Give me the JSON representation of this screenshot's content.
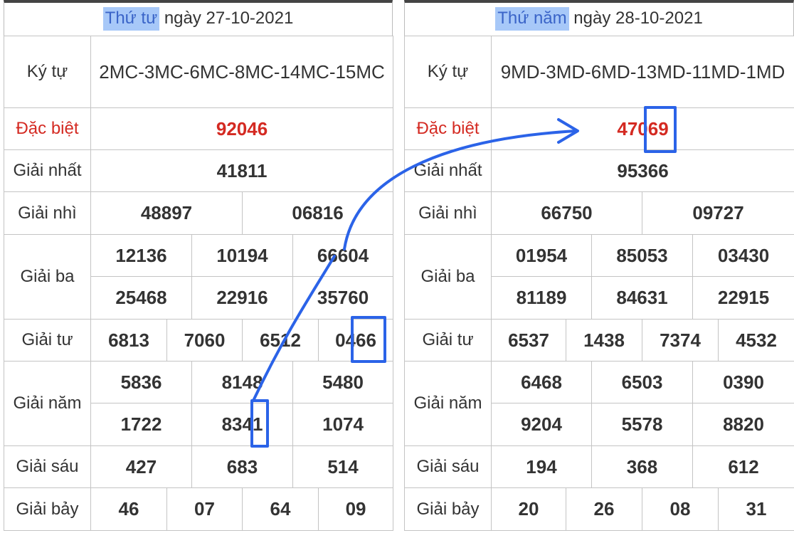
{
  "left": {
    "header_day": "Thứ tư",
    "header_rest": " ngày 27-10-2021",
    "ky_tu_label": "Ký tự",
    "ky_tu": "2MC-3MC-6MC-8MC-14MC-15MC",
    "prizes": {
      "db_label": "Đặc biệt",
      "db": "92046",
      "g1_label": "Giải nhất",
      "g1": "41811",
      "g2_label": "Giải nhì",
      "g2": [
        "48897",
        "06816"
      ],
      "g3_label": "Giải ba",
      "g3": [
        "12136",
        "10194",
        "66604",
        "25468",
        "22916",
        "35760"
      ],
      "g4_label": "Giải tư",
      "g4": [
        "6813",
        "7060",
        "6512",
        "0466"
      ],
      "g5_label": "Giải năm",
      "g5": [
        "5836",
        "8148",
        "5480",
        "1722",
        "8341",
        "1074"
      ],
      "g6_label": "Giải sáu",
      "g6": [
        "427",
        "683",
        "514"
      ],
      "g7_label": "Giải bảy",
      "g7": [
        "46",
        "07",
        "64",
        "09"
      ]
    }
  },
  "right": {
    "header_day": "Thứ năm",
    "header_rest": " ngày 28-10-2021",
    "ky_tu_label": "Ký tự",
    "ky_tu": "9MD-3MD-6MD-13MD-11MD-1MD",
    "prizes": {
      "db_label": "Đặc biệt",
      "db": "47069",
      "g1_label": "Giải nhất",
      "g1": "95366",
      "g2_label": "Giải nhì",
      "g2": [
        "66750",
        "09727"
      ],
      "g3_label": "Giải ba",
      "g3": [
        "01954",
        "85053",
        "03430",
        "81189",
        "84631",
        "22915"
      ],
      "g4_label": "Giải tư",
      "g4": [
        "6537",
        "1438",
        "7374",
        "4532"
      ],
      "g5_label": "Giải năm",
      "g5": [
        "6468",
        "6503",
        "0390",
        "9204",
        "5578",
        "8820"
      ],
      "g6_label": "Giải sáu",
      "g6": [
        "194",
        "368",
        "612"
      ],
      "g7_label": "Giải bảy",
      "g7": [
        "20",
        "26",
        "08",
        "31"
      ]
    }
  },
  "colors": {
    "special_prize": "#d42a22",
    "highlight_bg": "#a7c8f8",
    "annotation": "#2b63e8"
  }
}
